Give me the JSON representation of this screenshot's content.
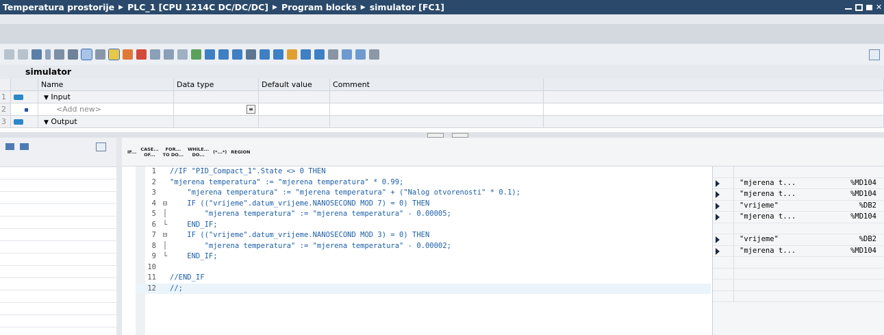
{
  "title": {
    "crumbs": [
      "Temperatura prostorije",
      "PLC_1 [CPU 1214C DC/DC/DC]",
      "Program blocks",
      "simulator [FC1]"
    ]
  },
  "block_name": "simulator",
  "interface": {
    "headers": {
      "name": "Name",
      "data_type": "Data type",
      "default_value": "Default value",
      "comment": "Comment"
    },
    "rows": [
      {
        "num": "1",
        "name": "Input",
        "type": "section"
      },
      {
        "num": "2",
        "name": "<Add new>",
        "type": "add"
      },
      {
        "num": "3",
        "name": "Output",
        "type": "section"
      }
    ]
  },
  "scl_instructions": [
    {
      "top": "IF...",
      "bottom": ""
    },
    {
      "top": "CASE...",
      "bottom": "OF..."
    },
    {
      "top": "FOR...",
      "bottom": "TO DO..."
    },
    {
      "top": "WHILE...",
      "bottom": "DO..."
    },
    {
      "top": "(*...*)",
      "bottom": ""
    },
    {
      "top": "REGION",
      "bottom": ""
    }
  ],
  "code_lines": [
    {
      "num": "1",
      "fold": "",
      "text": "//IF \"PID_Compact_1\".State <> 0 THEN"
    },
    {
      "num": "2",
      "fold": "",
      "text": "\"mjerena temperatura\" := \"mjerena temperatura\" * 0.99;"
    },
    {
      "num": "3",
      "fold": "",
      "text": "    \"mjerena temperatura\" := \"mjerena temperatura\" + (\"Nalog otvorenosti\" * 0.1);"
    },
    {
      "num": "4",
      "fold": "⊟",
      "text": "    IF ((\"vrijeme\".datum_vrijeme.NANOSECOND MOD 7) = 0) THEN"
    },
    {
      "num": "5",
      "fold": "│",
      "text": "        \"mjerena temperatura\" := \"mjerena temperatura\" - 0.00005;"
    },
    {
      "num": "6",
      "fold": "└",
      "text": "    END_IF;"
    },
    {
      "num": "7",
      "fold": "⊟",
      "text": "    IF ((\"vrijeme\".datum_vrijeme.NANOSECOND MOD 3) = 0) THEN"
    },
    {
      "num": "8",
      "fold": "│",
      "text": "        \"mjerena temperatura\" := \"mjerena temperatura\" - 0.00002;"
    },
    {
      "num": "9",
      "fold": "└",
      "text": "    END_IF;"
    },
    {
      "num": "10",
      "fold": "",
      "text": ""
    },
    {
      "num": "11",
      "fold": "",
      "text": "//END_IF"
    },
    {
      "num": "12",
      "fold": "",
      "text": "//;"
    }
  ],
  "xref_rows": [
    {
      "arrow": false,
      "tag": "",
      "addr": ""
    },
    {
      "arrow": true,
      "tag": "\"mjerena t...",
      "addr": "%MD104"
    },
    {
      "arrow": true,
      "tag": "\"mjerena t...",
      "addr": "%MD104"
    },
    {
      "arrow": true,
      "tag": "\"vrijeme\"",
      "addr": "%DB2"
    },
    {
      "arrow": true,
      "tag": "\"mjerena t...",
      "addr": "%MD104"
    },
    {
      "arrow": false,
      "tag": "",
      "addr": ""
    },
    {
      "arrow": true,
      "tag": "\"vrijeme\"",
      "addr": "%DB2"
    },
    {
      "arrow": true,
      "tag": "\"mjerena t...",
      "addr": "%MD104"
    },
    {
      "arrow": false,
      "tag": "",
      "addr": ""
    },
    {
      "arrow": false,
      "tag": "",
      "addr": ""
    },
    {
      "arrow": false,
      "tag": "",
      "addr": ""
    },
    {
      "arrow": false,
      "tag": "",
      "addr": ""
    }
  ],
  "colors": {
    "titlebar": "#2b4a6b",
    "accent": "#2d87c8"
  }
}
